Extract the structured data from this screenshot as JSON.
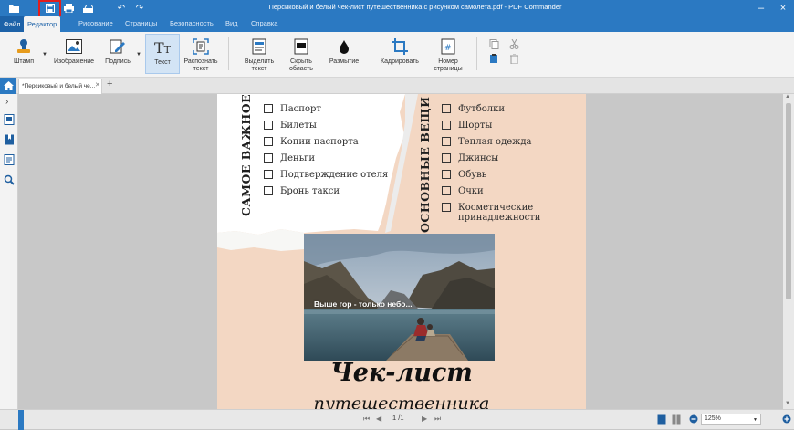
{
  "window": {
    "title": "Персиковый и белый чек-лист путешественника с рисунком самолета.pdf - PDF Commander"
  },
  "menu_tabs": [
    "Файл",
    "Редактор",
    "Рисование",
    "Страницы",
    "Безопасность",
    "Вид",
    "Справка"
  ],
  "ribbon": {
    "stamp": "Штамп",
    "image": "Изображение",
    "signature": "Подпись",
    "text": "Текст",
    "recognize": "Распознать текст",
    "highlight": "Выделить текст",
    "hide_area": "Скрыть область",
    "blur": "Размытие",
    "crop": "Кадрировать",
    "page_number": "Номер страницы"
  },
  "document_tab": {
    "label": "*Персиковый и белый че..."
  },
  "page": {
    "left_heading": "САМОЕ ВАЖНОЕ",
    "right_heading": "ОСНОВНЫЕ ВЕЩИ",
    "left_items": [
      "Паспорт",
      "Билеты",
      "Копии паспорта",
      "Деньги",
      "Подтверждение отеля",
      "Бронь такси"
    ],
    "right_items": [
      "Футболки",
      "Шорты",
      "Теплая одежда",
      "Джинсы",
      "Обувь",
      "Очки",
      "Косметические принадлежности"
    ],
    "photo_caption": "Выше гор - только небо...",
    "title": "Чек-лист",
    "subtitle": "путешественника"
  },
  "status": {
    "page_current": "1",
    "page_total": "/1",
    "zoom": "125%"
  },
  "colors": {
    "brand_blue": "#2b79c2",
    "page_peach": "#f3d7c3",
    "highlight_red": "#e01e1e"
  }
}
